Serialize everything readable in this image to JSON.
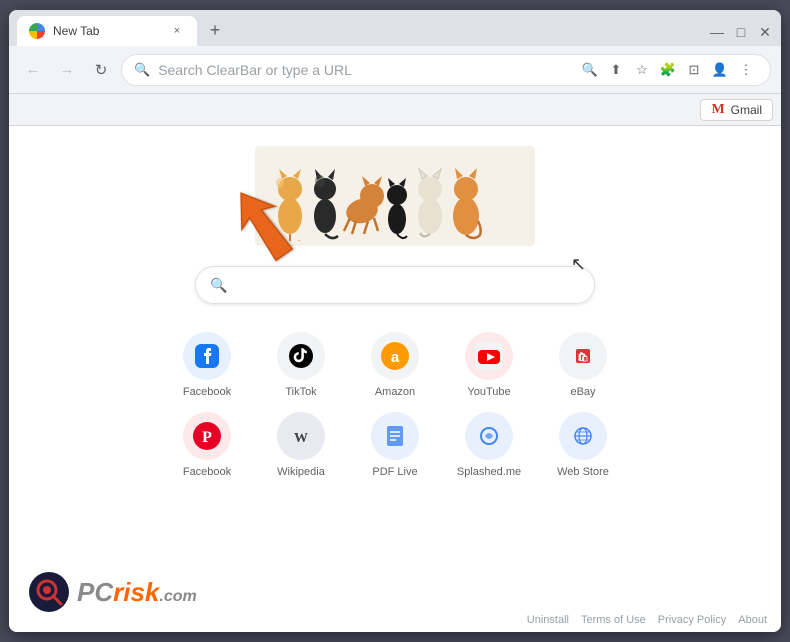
{
  "browser": {
    "tab": {
      "title": "New Tab",
      "close_label": "×"
    },
    "new_tab_button": "+",
    "window_controls": {
      "minimize": "—",
      "maximize": "□",
      "close": "✕"
    }
  },
  "nav": {
    "back_label": "←",
    "forward_label": "→",
    "reload_label": "↻",
    "address_placeholder": "Search ClearBar or type a URL",
    "search_icon": "🔍",
    "share_icon": "⬆",
    "bookmark_icon": "☆",
    "extensions_icon": "🧩",
    "sidebar_icon": "⬚",
    "profile_icon": "👤",
    "menu_icon": "⋮"
  },
  "bookmarks_bar": {
    "gmail_label": "Gmail",
    "gmail_m": "M"
  },
  "page": {
    "search_placeholder": "",
    "shortcuts": [
      {
        "row": 1,
        "items": [
          {
            "id": "facebook",
            "label": "Facebook",
            "icon": "f",
            "color": "#1877f2",
            "bg": "#e7f0fd"
          },
          {
            "id": "tiktok",
            "label": "TikTok",
            "icon": "♪",
            "color": "#ffffff",
            "bg": "#010101"
          },
          {
            "id": "amazon",
            "label": "Amazon",
            "icon": "a",
            "color": "#ffffff",
            "bg": "#ff9900"
          },
          {
            "id": "youtube",
            "label": "YouTube",
            "icon": "▶",
            "color": "#ffffff",
            "bg": "#ff0000"
          },
          {
            "id": "ebay",
            "label": "eBay",
            "icon": "🛍",
            "color": "#ffffff",
            "bg": "#e43137"
          }
        ]
      },
      {
        "row": 2,
        "items": [
          {
            "id": "pinterest",
            "label": "Pinterest",
            "icon": "P",
            "color": "#e60023",
            "bg": "#fde8ea"
          },
          {
            "id": "wikipedia",
            "label": "Wikipedia",
            "icon": "W",
            "color": "#3c4043",
            "bg": "#e8eaed"
          },
          {
            "id": "pdflive",
            "label": "PDF Live",
            "icon": "⊟",
            "color": "#2c7be5",
            "bg": "#e8f0fd"
          },
          {
            "id": "splashed",
            "label": "Splashed.me",
            "icon": "◈",
            "color": "#4285f4",
            "bg": "#e8f0fd"
          },
          {
            "id": "webstore",
            "label": "Web Store",
            "icon": "🌐",
            "color": "#4285f4",
            "bg": "#e8f0fd"
          }
        ]
      }
    ],
    "footer": {
      "links": [
        "Uninstall",
        "Terms of Use",
        "Privacy Policy",
        "About"
      ]
    }
  },
  "pcrisk": {
    "pc_text": "PC",
    "risk_text": "risk",
    "com_text": ".com"
  }
}
